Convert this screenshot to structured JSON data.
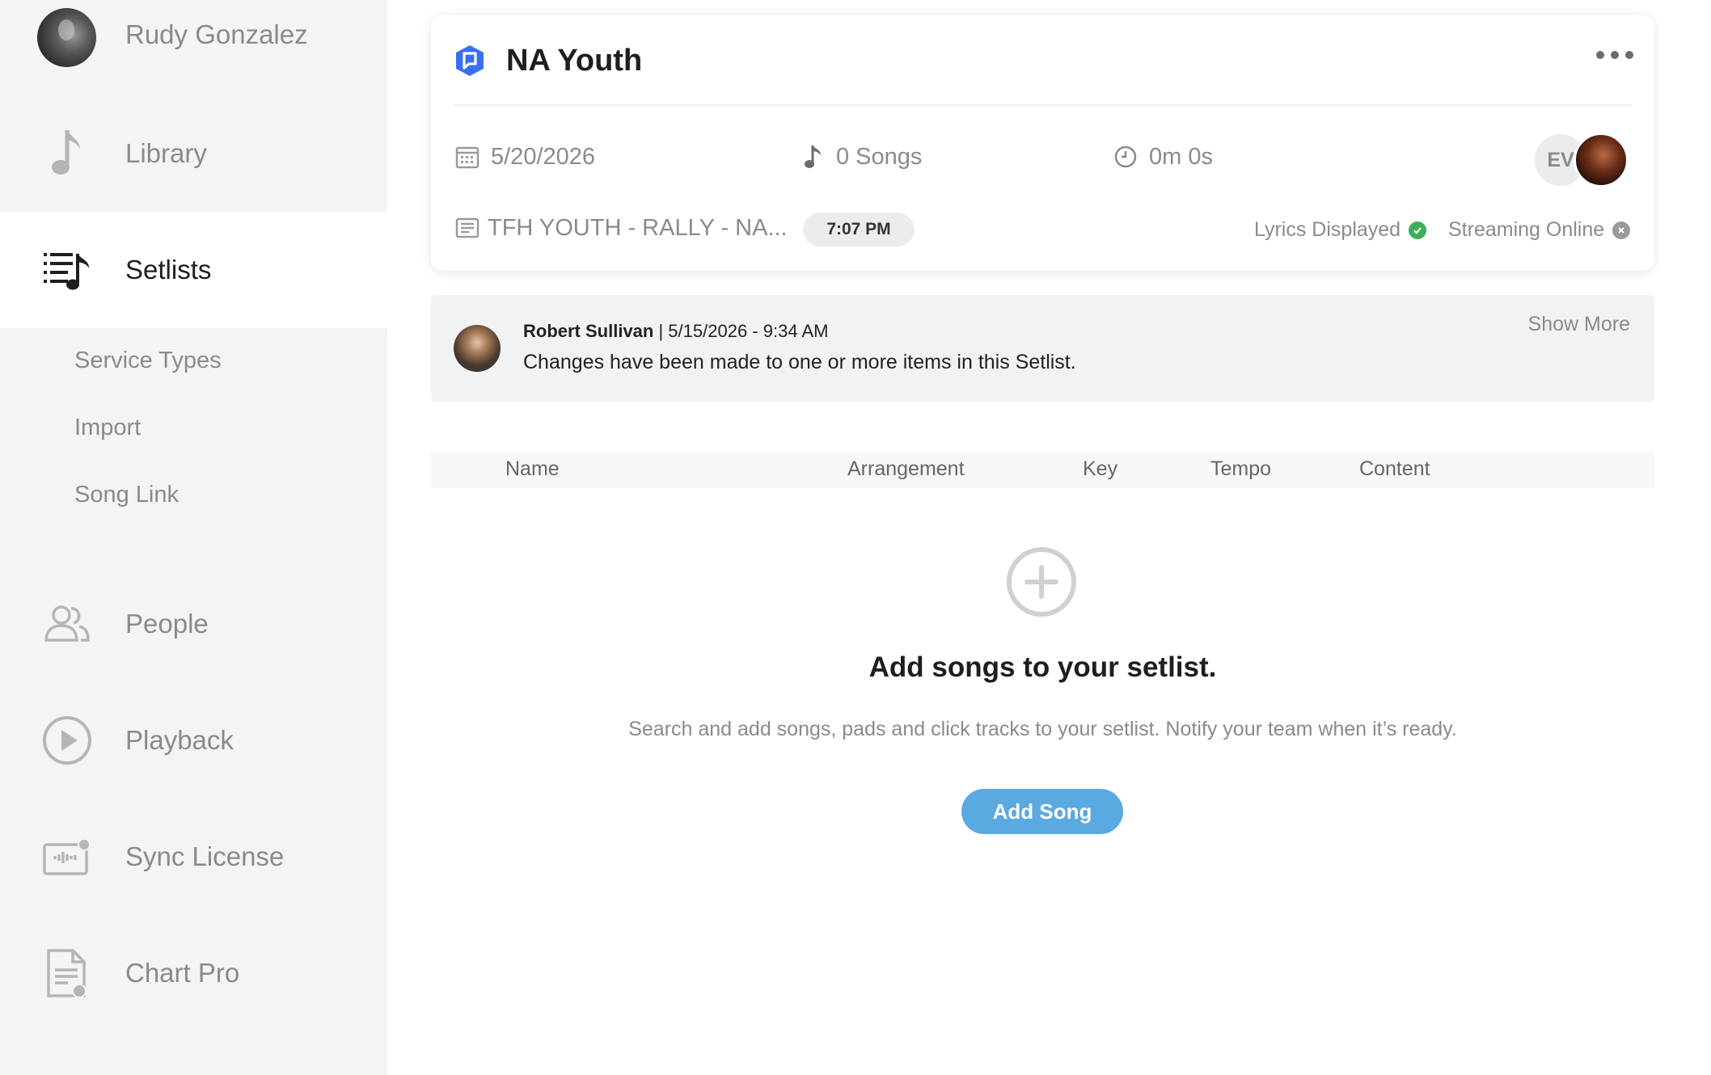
{
  "sidebar": {
    "user_name": "Rudy Gonzalez",
    "items": [
      {
        "label": "Library",
        "icon": "music-note-icon"
      },
      {
        "label": "Setlists",
        "icon": "setlist-icon"
      },
      {
        "label": "People",
        "icon": "people-icon"
      },
      {
        "label": "Playback",
        "icon": "play-circle-icon"
      },
      {
        "label": "Sync License",
        "icon": "sync-license-icon"
      },
      {
        "label": "Chart Pro",
        "icon": "chart-document-icon"
      }
    ],
    "sub_items": [
      "Service Types",
      "Import",
      "Song Link"
    ]
  },
  "setlist": {
    "title": "NA Youth",
    "date": "5/20/2026",
    "songs": "0 Songs",
    "duration": "0m 0s",
    "service_name": "TFH YOUTH - RALLY - NA...",
    "time": "7:07 PM",
    "member_initials": "EV",
    "lyrics_status": "Lyrics Displayed",
    "streaming_status": "Streaming Online",
    "colors": {
      "brand": "#3a6ff0",
      "lyrics_ok": "#3fae5a",
      "streaming_off": "#9a9a9a"
    }
  },
  "notice": {
    "author": "Robert Sullivan",
    "timestamp": "| 5/15/2026 - 9:34 AM",
    "message": "Changes have been made to one or more items in this Setlist.",
    "show_more": "Show More"
  },
  "table": {
    "headers": [
      "Name",
      "Arrangement",
      "Key",
      "Tempo",
      "Content"
    ]
  },
  "empty_state": {
    "title": "Add songs to your setlist.",
    "subtitle": "Search and add songs, pads and click tracks to your setlist. Notify your team when it’s ready.",
    "button": "Add Song",
    "button_color": "#5aa9e1"
  }
}
